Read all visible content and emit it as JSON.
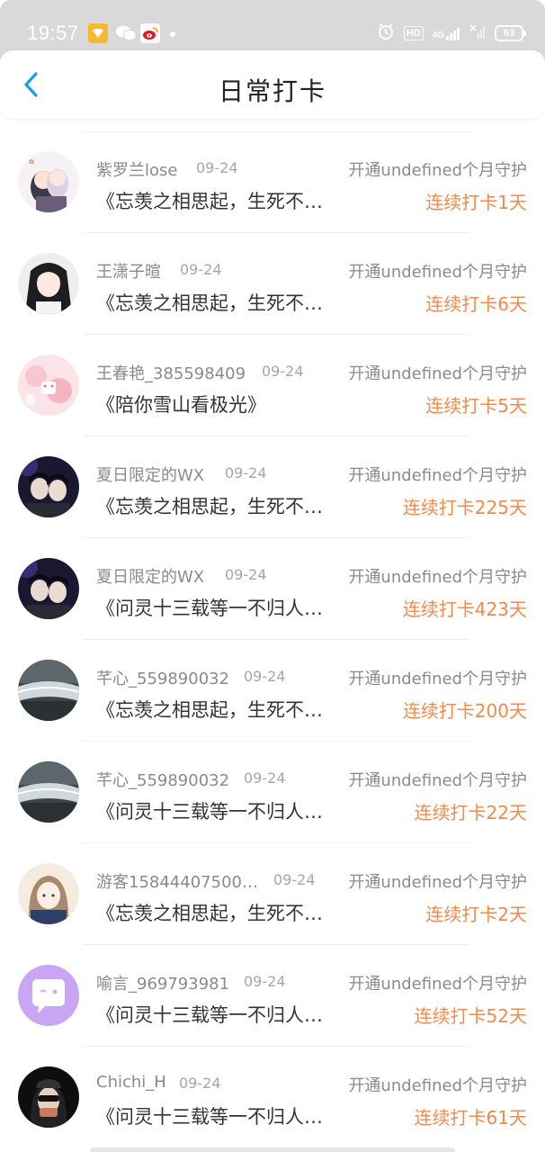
{
  "status_bar": {
    "time": "19:57",
    "hd_label": "HD",
    "network_label": "4G",
    "battery": "63"
  },
  "header": {
    "title": "日常打卡",
    "back_icon": "chevron-left-icon"
  },
  "colors": {
    "accent": "#1a9bf0",
    "streak": "#f4894a",
    "muted_text": "#8a8a8a"
  },
  "items": [
    {
      "name": "紫罗兰lose",
      "date": "09-24",
      "guard": "开通undefined个月守护",
      "title": "《忘羡之相思起，生死不…",
      "streak": "连续打卡1天"
    },
    {
      "name": "王潇子暄",
      "date": "09-24",
      "guard": "开通undefined个月守护",
      "title": "《忘羡之相思起，生死不…",
      "streak": "连续打卡6天"
    },
    {
      "name": "王春艳_385598409",
      "date": "09-24",
      "guard": "开通undefined个月守护",
      "title": "《陪你雪山看极光》",
      "streak": "连续打卡5天"
    },
    {
      "name": "夏日限定的WX",
      "date": "09-24",
      "guard": "开通undefined个月守护",
      "title": "《忘羡之相思起，生死不…",
      "streak": "连续打卡225天"
    },
    {
      "name": "夏日限定的WX",
      "date": "09-24",
      "guard": "开通undefined个月守护",
      "title": "《问灵十三载等一不归人…",
      "streak": "连续打卡423天"
    },
    {
      "name": "芊心_559890032",
      "date": "09-24",
      "guard": "开通undefined个月守护",
      "title": "《忘羡之相思起，生死不…",
      "streak": "连续打卡200天"
    },
    {
      "name": "芊心_559890032",
      "date": "09-24",
      "guard": "开通undefined个月守护",
      "title": "《问灵十三载等一不归人…",
      "streak": "连续打卡22天"
    },
    {
      "name": "游客15844407500…",
      "date": "09-24",
      "guard": "开通undefined个月守护",
      "title": "《忘羡之相思起，生死不…",
      "streak": "连续打卡2天"
    },
    {
      "name": "喻言_969793981",
      "date": "09-24",
      "guard": "开通undefined个月守护",
      "title": "《问灵十三载等一不归人…",
      "streak": "连续打卡52天"
    },
    {
      "name": "Chichi_H",
      "date": "09-24",
      "guard": "开通undefined个月守护",
      "title": "《问灵十三载等一不归人…",
      "streak": "连续打卡61天"
    }
  ]
}
